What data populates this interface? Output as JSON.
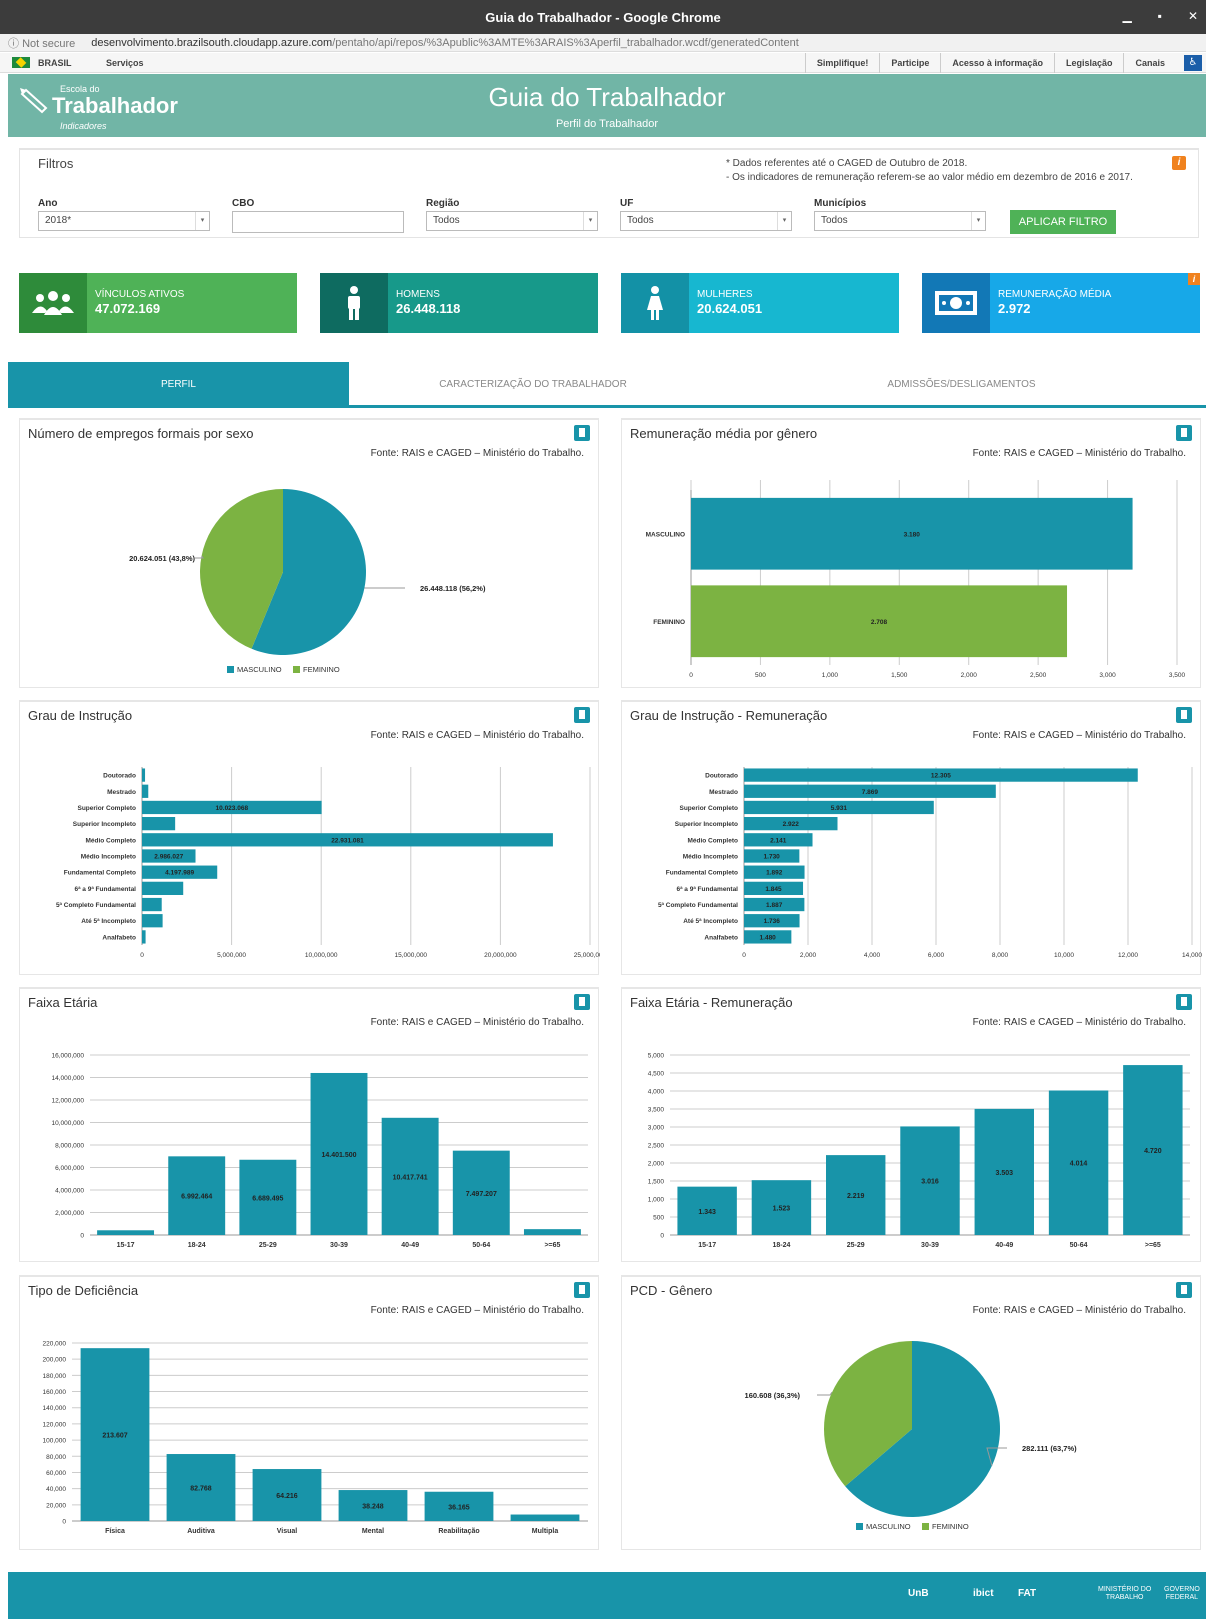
{
  "browser": {
    "window_title": "Guia do Trabalhador - Google Chrome",
    "security": "Not secure",
    "url_host": "desenvolvimento.brazilsouth.cloudapp.azure.com",
    "url_path": "/pentaho/api/repos/%3Apublic%3AMTE%3ARAIS%3Aperfil_trabalhador.wcdf/generatedContent"
  },
  "govbar": {
    "brasil": "BRASIL",
    "servicos": "Serviços",
    "links": [
      "Simplifique!",
      "Participe",
      "Acesso à informação",
      "Legislação",
      "Canais"
    ]
  },
  "header": {
    "logo_top": "Escola do",
    "logo_main": "Trabalhador",
    "logo_sub": "Indicadores",
    "title": "Guia do Trabalhador",
    "subtitle": "Perfil do Trabalhador"
  },
  "filters": {
    "title": "Filtros",
    "note1": "* Dados referentes até o CAGED de Outubro de 2018.",
    "note2": "- Os indicadores de remuneração referem-se ao valor médio em dezembro de 2016 e 2017.",
    "fields": [
      {
        "label": "Ano",
        "value": "2018*"
      },
      {
        "label": "CBO",
        "value": ""
      },
      {
        "label": "Região",
        "value": "Todos"
      },
      {
        "label": "UF",
        "value": "Todos"
      },
      {
        "label": "Municípios",
        "value": "Todos"
      }
    ],
    "apply_label": "APLICAR FILTRO"
  },
  "kpis": [
    {
      "label": "VÍNCULOS ATIVOS",
      "value": "47.072.169",
      "color": "#4fb257",
      "icon_color": "#2e8b3a"
    },
    {
      "label": "HOMENS",
      "value": "26.448.118",
      "color": "#17998a",
      "icon_color": "#0e6b60"
    },
    {
      "label": "MULHERES",
      "value": "20.624.051",
      "color": "#17b7d0",
      "icon_color": "#1391a6"
    },
    {
      "label": "REMUNERAÇÃO MÉDIA",
      "value": "2.972",
      "color": "#17a8e8",
      "icon_color": "#1278b6"
    }
  ],
  "tabs": [
    {
      "label": "PERFIL",
      "active": true
    },
    {
      "label": "CARACTERIZAÇÃO DO TRABALHADOR",
      "active": false
    },
    {
      "label": "ADMISSÕES/DESLIGAMENTOS",
      "active": false
    }
  ],
  "source_text": "Fonte: RAIS e CAGED – Ministério do Trabalho.",
  "colors": {
    "teal": "#1894a9",
    "green": "#7cb342"
  },
  "footer": {
    "items": [
      "UnB",
      "ibict",
      "FAT"
    ],
    "ministry": [
      "MINISTÉRIO DO",
      "TRABALHO"
    ],
    "gov": [
      "GOVERNO",
      "FEDERAL"
    ]
  },
  "chart_data": [
    {
      "id": "sexo",
      "type": "pie",
      "title": "Número de empregos formais por sexo",
      "legend": [
        "MASCULINO",
        "FEMININO"
      ],
      "values": [
        26448118,
        20624051
      ],
      "labels": [
        "26.448.118 (56,2%)",
        "20.624.051 (43,8%)"
      ]
    },
    {
      "id": "remgenero",
      "type": "bar",
      "orientation": "horizontal",
      "title": "Remuneração média por gênero",
      "categories": [
        "MASCULINO",
        "FEMININO"
      ],
      "values": [
        3180,
        2708
      ],
      "value_labels": [
        "3.180",
        "2.708"
      ],
      "xlim": [
        0,
        3500
      ],
      "ticks": [
        0,
        500,
        1000,
        1500,
        2000,
        2500,
        3000,
        3500
      ],
      "tick_labels": [
        "0",
        "500",
        "1,000",
        "1,500",
        "2,000",
        "2,500",
        "3,000",
        "3,500"
      ]
    },
    {
      "id": "instrucao",
      "type": "bar",
      "orientation": "horizontal",
      "title": "Grau de Instrução",
      "categories": [
        "Doutorado",
        "Mestrado",
        "Superior Completo",
        "Superior Incompleto",
        "Médio Completo",
        "Médio Incompleto",
        "Fundamental Completo",
        "6ª a 9ª Fundamental",
        "5ª Completo Fundamental",
        "Até 5ª Incompleto",
        "Analfabeto"
      ],
      "values": [
        170000,
        350000,
        10023068,
        1850000,
        22931081,
        2986027,
        4197989,
        2300000,
        1100000,
        1150000,
        200000
      ],
      "value_labels": [
        "",
        "",
        "10.023.068",
        "",
        "22.931.081",
        "2.986.027",
        "4.197.989",
        "",
        "",
        "",
        ""
      ],
      "xlim": [
        0,
        25000000
      ],
      "ticks": [
        0,
        5000000,
        10000000,
        15000000,
        20000000,
        25000000
      ],
      "tick_labels": [
        "0",
        "5,000,000",
        "10,000,000",
        "15,000,000",
        "20,000,000",
        "25,000,000"
      ]
    },
    {
      "id": "instrucaorem",
      "type": "bar",
      "orientation": "horizontal",
      "title": "Grau de Instrução - Remuneração",
      "categories": [
        "Doutorado",
        "Mestrado",
        "Superior Completo",
        "Superior Incompleto",
        "Médio Completo",
        "Médio Incompleto",
        "Fundamental Completo",
        "6ª a 9ª Fundamental",
        "5ª Completo Fundamental",
        "Até 5ª Incompleto",
        "Analfabeto"
      ],
      "values": [
        12305,
        7869,
        5931,
        2922,
        2141,
        1730,
        1892,
        1845,
        1887,
        1736,
        1480
      ],
      "value_labels": [
        "12.305",
        "7.869",
        "5.931",
        "2.922",
        "2.141",
        "1.730",
        "1.892",
        "1.845",
        "1.887",
        "1.736",
        "1.480"
      ],
      "xlim": [
        0,
        14000
      ],
      "ticks": [
        0,
        2000,
        4000,
        6000,
        8000,
        10000,
        12000,
        14000
      ],
      "tick_labels": [
        "0",
        "2,000",
        "4,000",
        "6,000",
        "8,000",
        "10,000",
        "12,000",
        "14,000"
      ]
    },
    {
      "id": "faixa",
      "type": "bar",
      "orientation": "vertical",
      "title": "Faixa Etária",
      "categories": [
        "15-17",
        "18-24",
        "25-29",
        "30-39",
        "40-49",
        "50-64",
        ">=65"
      ],
      "values": [
        420000,
        6992464,
        6689495,
        14401500,
        10417741,
        7497207,
        520000
      ],
      "value_labels": [
        "",
        "6.992.464",
        "6.689.495",
        "14.401.500",
        "10.417.741",
        "7.497.207",
        ""
      ],
      "ylim": [
        0,
        16000000
      ],
      "ticks": [
        0,
        2000000,
        4000000,
        6000000,
        8000000,
        10000000,
        12000000,
        14000000,
        16000000
      ],
      "tick_labels": [
        "0",
        "2,000,000",
        "4,000,000",
        "6,000,000",
        "8,000,000",
        "10,000,000",
        "12,000,000",
        "14,000,000",
        "16,000,000"
      ]
    },
    {
      "id": "faixarem",
      "type": "bar",
      "orientation": "vertical",
      "title": "Faixa Etária - Remuneração",
      "categories": [
        "15-17",
        "18-24",
        "25-29",
        "30-39",
        "40-49",
        "50-64",
        ">=65"
      ],
      "values": [
        1343,
        1523,
        2219,
        3016,
        3503,
        4014,
        4720
      ],
      "value_labels": [
        "1.343",
        "1.523",
        "2.219",
        "3.016",
        "3.503",
        "4.014",
        "4.720"
      ],
      "ylim": [
        0,
        5000
      ],
      "ticks": [
        0,
        500,
        1000,
        1500,
        2000,
        2500,
        3000,
        3500,
        4000,
        4500,
        5000
      ],
      "tick_labels": [
        "0",
        "500",
        "1,000",
        "1,500",
        "2,000",
        "2,500",
        "3,000",
        "3,500",
        "4,000",
        "4,500",
        "5,000"
      ]
    },
    {
      "id": "deficiencia",
      "type": "bar",
      "orientation": "vertical",
      "title": "Tipo de Deficiência",
      "categories": [
        "Física",
        "Auditiva",
        "Visual",
        "Mental",
        "Reabilitação",
        "Multipla"
      ],
      "values": [
        213607,
        82768,
        64216,
        38248,
        36165,
        8000
      ],
      "value_labels": [
        "213.607",
        "82.768",
        "64.216",
        "38.248",
        "36.165",
        ""
      ],
      "ylim": [
        0,
        220000
      ],
      "ticks": [
        0,
        20000,
        40000,
        60000,
        80000,
        100000,
        120000,
        140000,
        160000,
        180000,
        200000,
        220000
      ],
      "tick_labels": [
        "0",
        "20,000",
        "40,000",
        "60,000",
        "80,000",
        "100,000",
        "120,000",
        "140,000",
        "160,000",
        "180,000",
        "200,000",
        "220,000"
      ]
    },
    {
      "id": "pcdgenero",
      "type": "pie",
      "title": "PCD - Gênero",
      "legend": [
        "MASCULINO",
        "FEMININO"
      ],
      "values": [
        282111,
        160608
      ],
      "labels": [
        "282.111 (63,7%)",
        "160.608 (36,3%)"
      ]
    }
  ]
}
